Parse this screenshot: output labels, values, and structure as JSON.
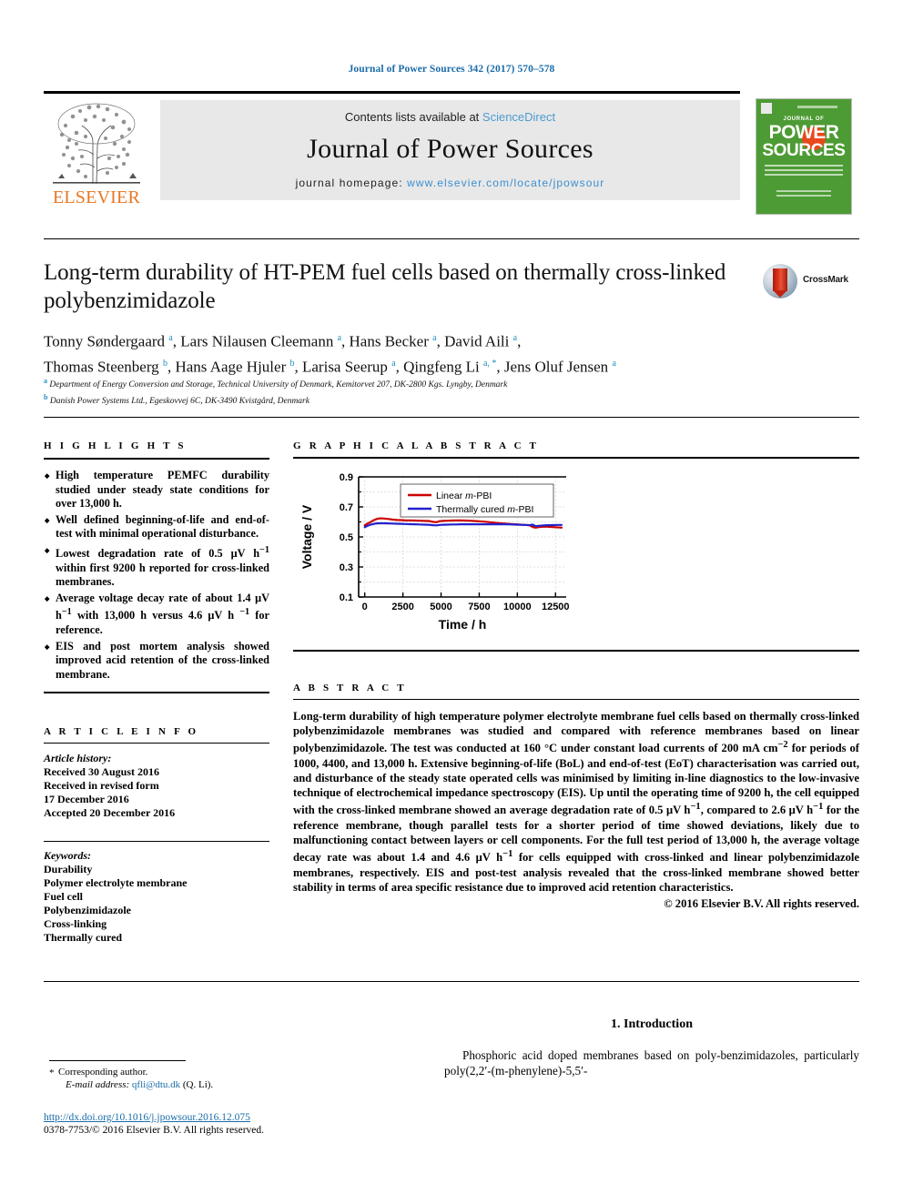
{
  "running_head": "Journal of Power Sources 342 (2017) 570–578",
  "masthead": {
    "contents_prefix": "Contents lists available at ",
    "sciencedirect": "ScienceDirect",
    "journal_title": "Journal of Power Sources",
    "homepage_prefix": "journal homepage: ",
    "homepage_url": "www.elsevier.com/locate/jpowsour",
    "publisher": "ELSEVIER",
    "cover": {
      "journal_of": "JOURNAL OF",
      "power": "POWER",
      "sources": "SOURCES"
    }
  },
  "article": {
    "title": "Long-term durability of HT-PEM fuel cells based on thermally cross-linked polybenzimidazole",
    "crossmark_label": "CrossMark",
    "authors_line1": "Tonny Søndergaard <sup>a</sup>, Lars Nilausen Cleemann <sup>a</sup>, Hans Becker <sup>a</sup>, David Aili <sup>a</sup>,",
    "authors_line2": "Thomas Steenberg <sup>b</sup>, Hans Aage Hjuler <sup>b</sup>, Larisa Seerup <sup>a</sup>, Qingfeng Li <sup>a, *</sup>, Jens Oluf Jensen <sup>a</sup>",
    "affiliation_a": "<sup>a</sup> Department of Energy Conversion and Storage, Technical University of Denmark, Kemitorvet 207, DK-2800 Kgs. Lyngby, Denmark",
    "affiliation_b": "<sup>b</sup> Danish Power Systems Ltd., Egeskovvej 6C, DK-3490 Kvistgård, Denmark"
  },
  "highlights": {
    "heading": "H I G H L I G H T S",
    "items": [
      "High temperature PEMFC durability studied under steady state conditions for over 13,000 h.",
      "Well defined beginning-of-life and end-of-test with minimal operational disturbance.",
      "Lowest degradation rate of 0.5 μV h<sup>−1</sup> within first 9200 h reported for cross-linked membranes.",
      "Average voltage decay rate of about 1.4 μV h<sup>−1</sup> with 13,000 h versus 4.6 μV h <sup>−1</sup> for reference.",
      "EIS and post mortem analysis showed improved acid retention of the cross-linked membrane."
    ]
  },
  "article_info": {
    "heading": "A R T I C L E  I N F O",
    "history_label": "Article history:",
    "history_lines": [
      "Received 30 August 2016",
      "Received in revised form",
      "17 December 2016",
      "Accepted 20 December 2016"
    ],
    "keywords_label": "Keywords:",
    "keywords": [
      "Durability",
      "Polymer electrolyte membrane",
      "Fuel cell",
      "Polybenzimidazole",
      "Cross-linking",
      "Thermally cured"
    ]
  },
  "graphical_abstract": {
    "heading": "G R A P H I C A L  A B S T R A C T"
  },
  "abstract": {
    "heading": "A B S T R A C T",
    "paragraphs": [
      "Long-term durability of high temperature polymer electrolyte membrane fuel cells based on thermally cross-linked polybenzimidazole membranes was studied and compared with reference membranes based on linear polybenzimidazole. The test was conducted at 160 °C under constant load currents of 200 mA cm<sup>−2</sup> for periods of 1000, 4400, and 13,000 h. Extensive beginning-of-life (BoL) and end-of-test (EoT) characterisation was carried out, and disturbance of the steady state operated cells was minimised by limiting in-line diagnostics to the low-invasive technique of electrochemical impedance spectroscopy (EIS). Up until the operating time of 9200 h, the cell equipped with the cross-linked membrane showed an average degradation rate of 0.5 μV h<sup>−1</sup>, compared to 2.6 μV h<sup>−1</sup> for the reference membrane, though parallel tests for a shorter period of time showed deviations, likely due to malfunctioning contact between layers or cell components. For the full test period of 13,000 h, the average voltage decay rate was about 1.4 and 4.6 μV h<sup>−1</sup> for cells equipped with cross-linked and linear polybenzimidazole membranes, respectively. EIS and post-test analysis revealed that the cross-linked membrane showed better stability in terms of area specific resistance due to improved acid retention characteristics."
    ],
    "copyright": "© 2016 Elsevier B.V. All rights reserved."
  },
  "introduction": {
    "heading": "1. Introduction",
    "paragraph": "Phosphoric acid doped membranes based on poly-benzimidazoles, particularly poly(2,2′-(m-phenylene)-5,5′-"
  },
  "footer": {
    "corresponding_star": "*",
    "corresponding_label": "Corresponding author.",
    "email_label": "E-mail address:",
    "email": "qfli@dtu.dk",
    "email_owner": "(Q. Li).",
    "doi": "http://dx.doi.org/10.1016/j.jpowsour.2016.12.075",
    "issn": "0378-7753/© 2016 Elsevier B.V. All rights reserved."
  },
  "colors": {
    "link_blue": "#1a6ca8",
    "sciencedirect_blue": "#4a9bd1",
    "elsevier_orange": "#E87722",
    "superscript_blue": "#1a8fbf",
    "series_red": "#cc0000",
    "series_blue": "#2222cc",
    "cover_green": "#4d9b34"
  },
  "chart_data": {
    "type": "line",
    "title": "",
    "xlabel": "Time / h",
    "ylabel": "Voltage / V",
    "xlim": [
      -400,
      13200
    ],
    "ylim": [
      0.1,
      0.9
    ],
    "xticks": [
      0,
      2500,
      5000,
      7500,
      10000,
      12500
    ],
    "yticks": [
      0.1,
      0.3,
      0.5,
      0.7,
      0.9
    ],
    "yminorticks": [
      0.2,
      0.4,
      0.6,
      0.8
    ],
    "grid": true,
    "legend_position": "top-center",
    "series": [
      {
        "name": "Linear m-PBI",
        "color": "#cc0000",
        "x": [
          0,
          200,
          400,
          600,
          800,
          1000,
          1200,
          1500,
          1800,
          2100,
          2400,
          2700,
          3000,
          3300,
          3600,
          3900,
          4200,
          4500,
          4700,
          4900,
          5100,
          5400,
          5700,
          6000,
          6300,
          6600,
          6900,
          7200,
          7500,
          7800,
          8100,
          8400,
          8700,
          9000,
          9300,
          9600,
          9900,
          10200,
          10500,
          10800,
          11000,
          11200,
          11400,
          11700,
          12000,
          12300,
          12600,
          12900
        ],
        "y": [
          0.578,
          0.59,
          0.6,
          0.612,
          0.62,
          0.624,
          0.623,
          0.62,
          0.616,
          0.613,
          0.612,
          0.61,
          0.61,
          0.609,
          0.608,
          0.607,
          0.606,
          0.6,
          0.598,
          0.605,
          0.607,
          0.608,
          0.609,
          0.61,
          0.61,
          0.609,
          0.608,
          0.606,
          0.604,
          0.602,
          0.599,
          0.596,
          0.593,
          0.59,
          0.588,
          0.586,
          0.584,
          0.582,
          0.58,
          0.578,
          0.566,
          0.562,
          0.566,
          0.568,
          0.568,
          0.566,
          0.564,
          0.562
        ]
      },
      {
        "name": "Thermally cured m-PBI",
        "color": "#2222cc",
        "x": [
          0,
          200,
          400,
          600,
          800,
          1000,
          1200,
          1500,
          1800,
          2100,
          2400,
          2700,
          3000,
          3300,
          3600,
          3900,
          4200,
          4500,
          4700,
          4900,
          5100,
          5400,
          5700,
          6000,
          6300,
          6600,
          6900,
          7200,
          7500,
          7800,
          8100,
          8400,
          8700,
          9000,
          9300,
          9600,
          9900,
          10200,
          10500,
          10800,
          11000,
          11200,
          11400,
          11700,
          12000,
          12300,
          12600,
          12900
        ],
        "y": [
          0.565,
          0.575,
          0.582,
          0.587,
          0.59,
          0.591,
          0.591,
          0.59,
          0.589,
          0.588,
          0.587,
          0.586,
          0.585,
          0.584,
          0.583,
          0.582,
          0.581,
          0.578,
          0.577,
          0.58,
          0.581,
          0.582,
          0.583,
          0.583,
          0.584,
          0.584,
          0.584,
          0.584,
          0.584,
          0.584,
          0.584,
          0.584,
          0.584,
          0.584,
          0.584,
          0.583,
          0.582,
          0.581,
          0.58,
          0.578,
          0.582,
          0.572,
          0.574,
          0.577,
          0.578,
          0.579,
          0.58,
          0.58
        ]
      }
    ]
  }
}
